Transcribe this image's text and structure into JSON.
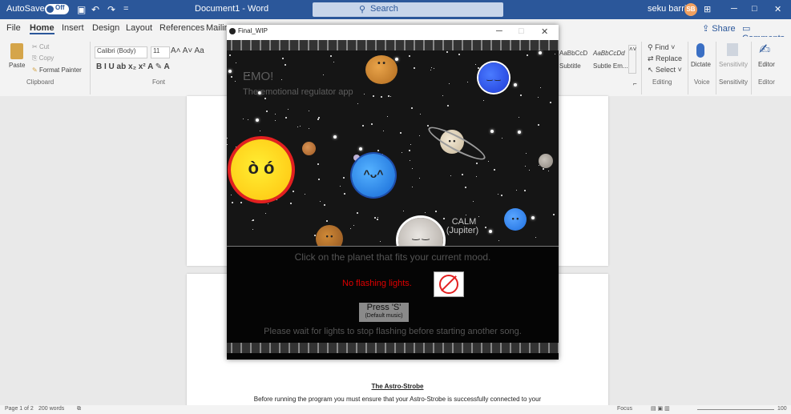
{
  "word": {
    "autosave_label": "AutoSave",
    "autosave_state": "Off",
    "doc_title": "Document1 - Word",
    "search_placeholder": "Search",
    "user_name": "seku barris",
    "user_initials": "SB",
    "menu": [
      "File",
      "Home",
      "Insert",
      "Design",
      "Layout",
      "References",
      "Mailin"
    ],
    "share": "Share",
    "comments": "Comments",
    "clipboard": {
      "paste": "Paste",
      "cut": "Cut",
      "copy": "Copy",
      "format_painter": "Format Painter",
      "group": "Clipboard"
    },
    "font": {
      "name": "Calibri (Body)",
      "size": "11",
      "group": "Font"
    },
    "styles": [
      "AaBbCcD",
      "AaBbCcDd",
      "Subtitle",
      "Subtle Em..."
    ],
    "editing": {
      "find": "Find",
      "replace": "Replace",
      "select": "Select",
      "group": "Editing"
    },
    "voice": {
      "dictate": "Dictate",
      "group": "Voice"
    },
    "sensitivity": {
      "label": "Sensitivity",
      "group": "Sensitivity"
    },
    "editor": {
      "label": "Editor",
      "group": "Editor"
    },
    "doc_heading": "The Astro-Strobe",
    "doc_line": "Before running the program you must ensure that your Astro-Strobe is successfully connected to your",
    "status": {
      "page": "Page 1 of 2",
      "words": "200 words",
      "focus": "Focus",
      "zoom": "100"
    }
  },
  "game": {
    "window_title": "Final_WIP",
    "app_name": "EMO!",
    "app_subtitle": "The emotional regulator app",
    "mood_label": "CALM",
    "mood_planet": "(Jupiter)",
    "instruction": "Click on the planet that fits your current mood.",
    "warning": "No flashing lights.",
    "press_label": "Press 'S'",
    "press_sub": "(Default music)",
    "wait_text": "Please wait for lights to stop flashing before starting another song."
  },
  "colors": {
    "word_blue": "#2b579a",
    "warning_red": "#e00000",
    "sun": "#ffd21a",
    "sun_ring": "#e32020"
  }
}
